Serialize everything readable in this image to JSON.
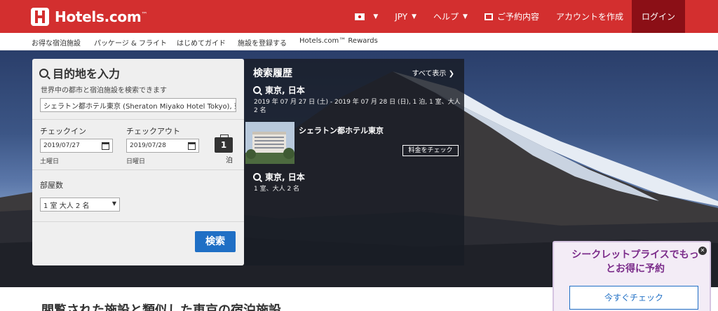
{
  "header": {
    "brand": "Hotels.com",
    "brand_tm": "™",
    "currency": "JPY",
    "help": "ヘルプ",
    "reservations": "ご予約内容",
    "create_account": "アカウントを作成",
    "login": "ログイン"
  },
  "subnav": {
    "items": [
      "お得な宿泊施設",
      "パッケージ & フライト",
      "はじめてガイド",
      "施設を登録する",
      "Hotels.com™ Rewards"
    ]
  },
  "search": {
    "title": "目的地を入力",
    "subtitle": "世界中の都市と宿泊施設を検索できます",
    "destination_value": "シェラトン都ホテル東京 (Sheraton Miyako Hotel Tokyo), 東京, 日",
    "checkin_label": "チェックイン",
    "checkout_label": "チェックアウト",
    "checkin_value": "2019/07/27",
    "checkout_value": "2019/07/28",
    "checkin_dow": "土曜日",
    "checkout_dow": "日曜日",
    "nights": "1",
    "nights_label": "泊",
    "rooms_label": "部屋数",
    "rooms_value": "1 室 大人 2 名",
    "search_button": "検索"
  },
  "history": {
    "title": "検索履歴",
    "view_all": "すべて表示",
    "entries": [
      {
        "destination": "東京, 日本",
        "detail1": "2019 年 07 月 27 日 (土) - 2019 年 07 月 28 日 (日), 1 泊, 1 室、大人",
        "detail2": "2 名"
      },
      {
        "destination": "東京, 日本",
        "detail1": "1 室、大人 2 名"
      }
    ],
    "hotel_name": "シェラトン都ホテル東京",
    "check_price": "料金をチェック"
  },
  "secret": {
    "line1": "シークレットプライスでもっ",
    "line2": "とお得に予約",
    "button": "今すぐチェック"
  },
  "section": {
    "heading": "閲覧された施設と類似した東京の宿泊施設"
  }
}
